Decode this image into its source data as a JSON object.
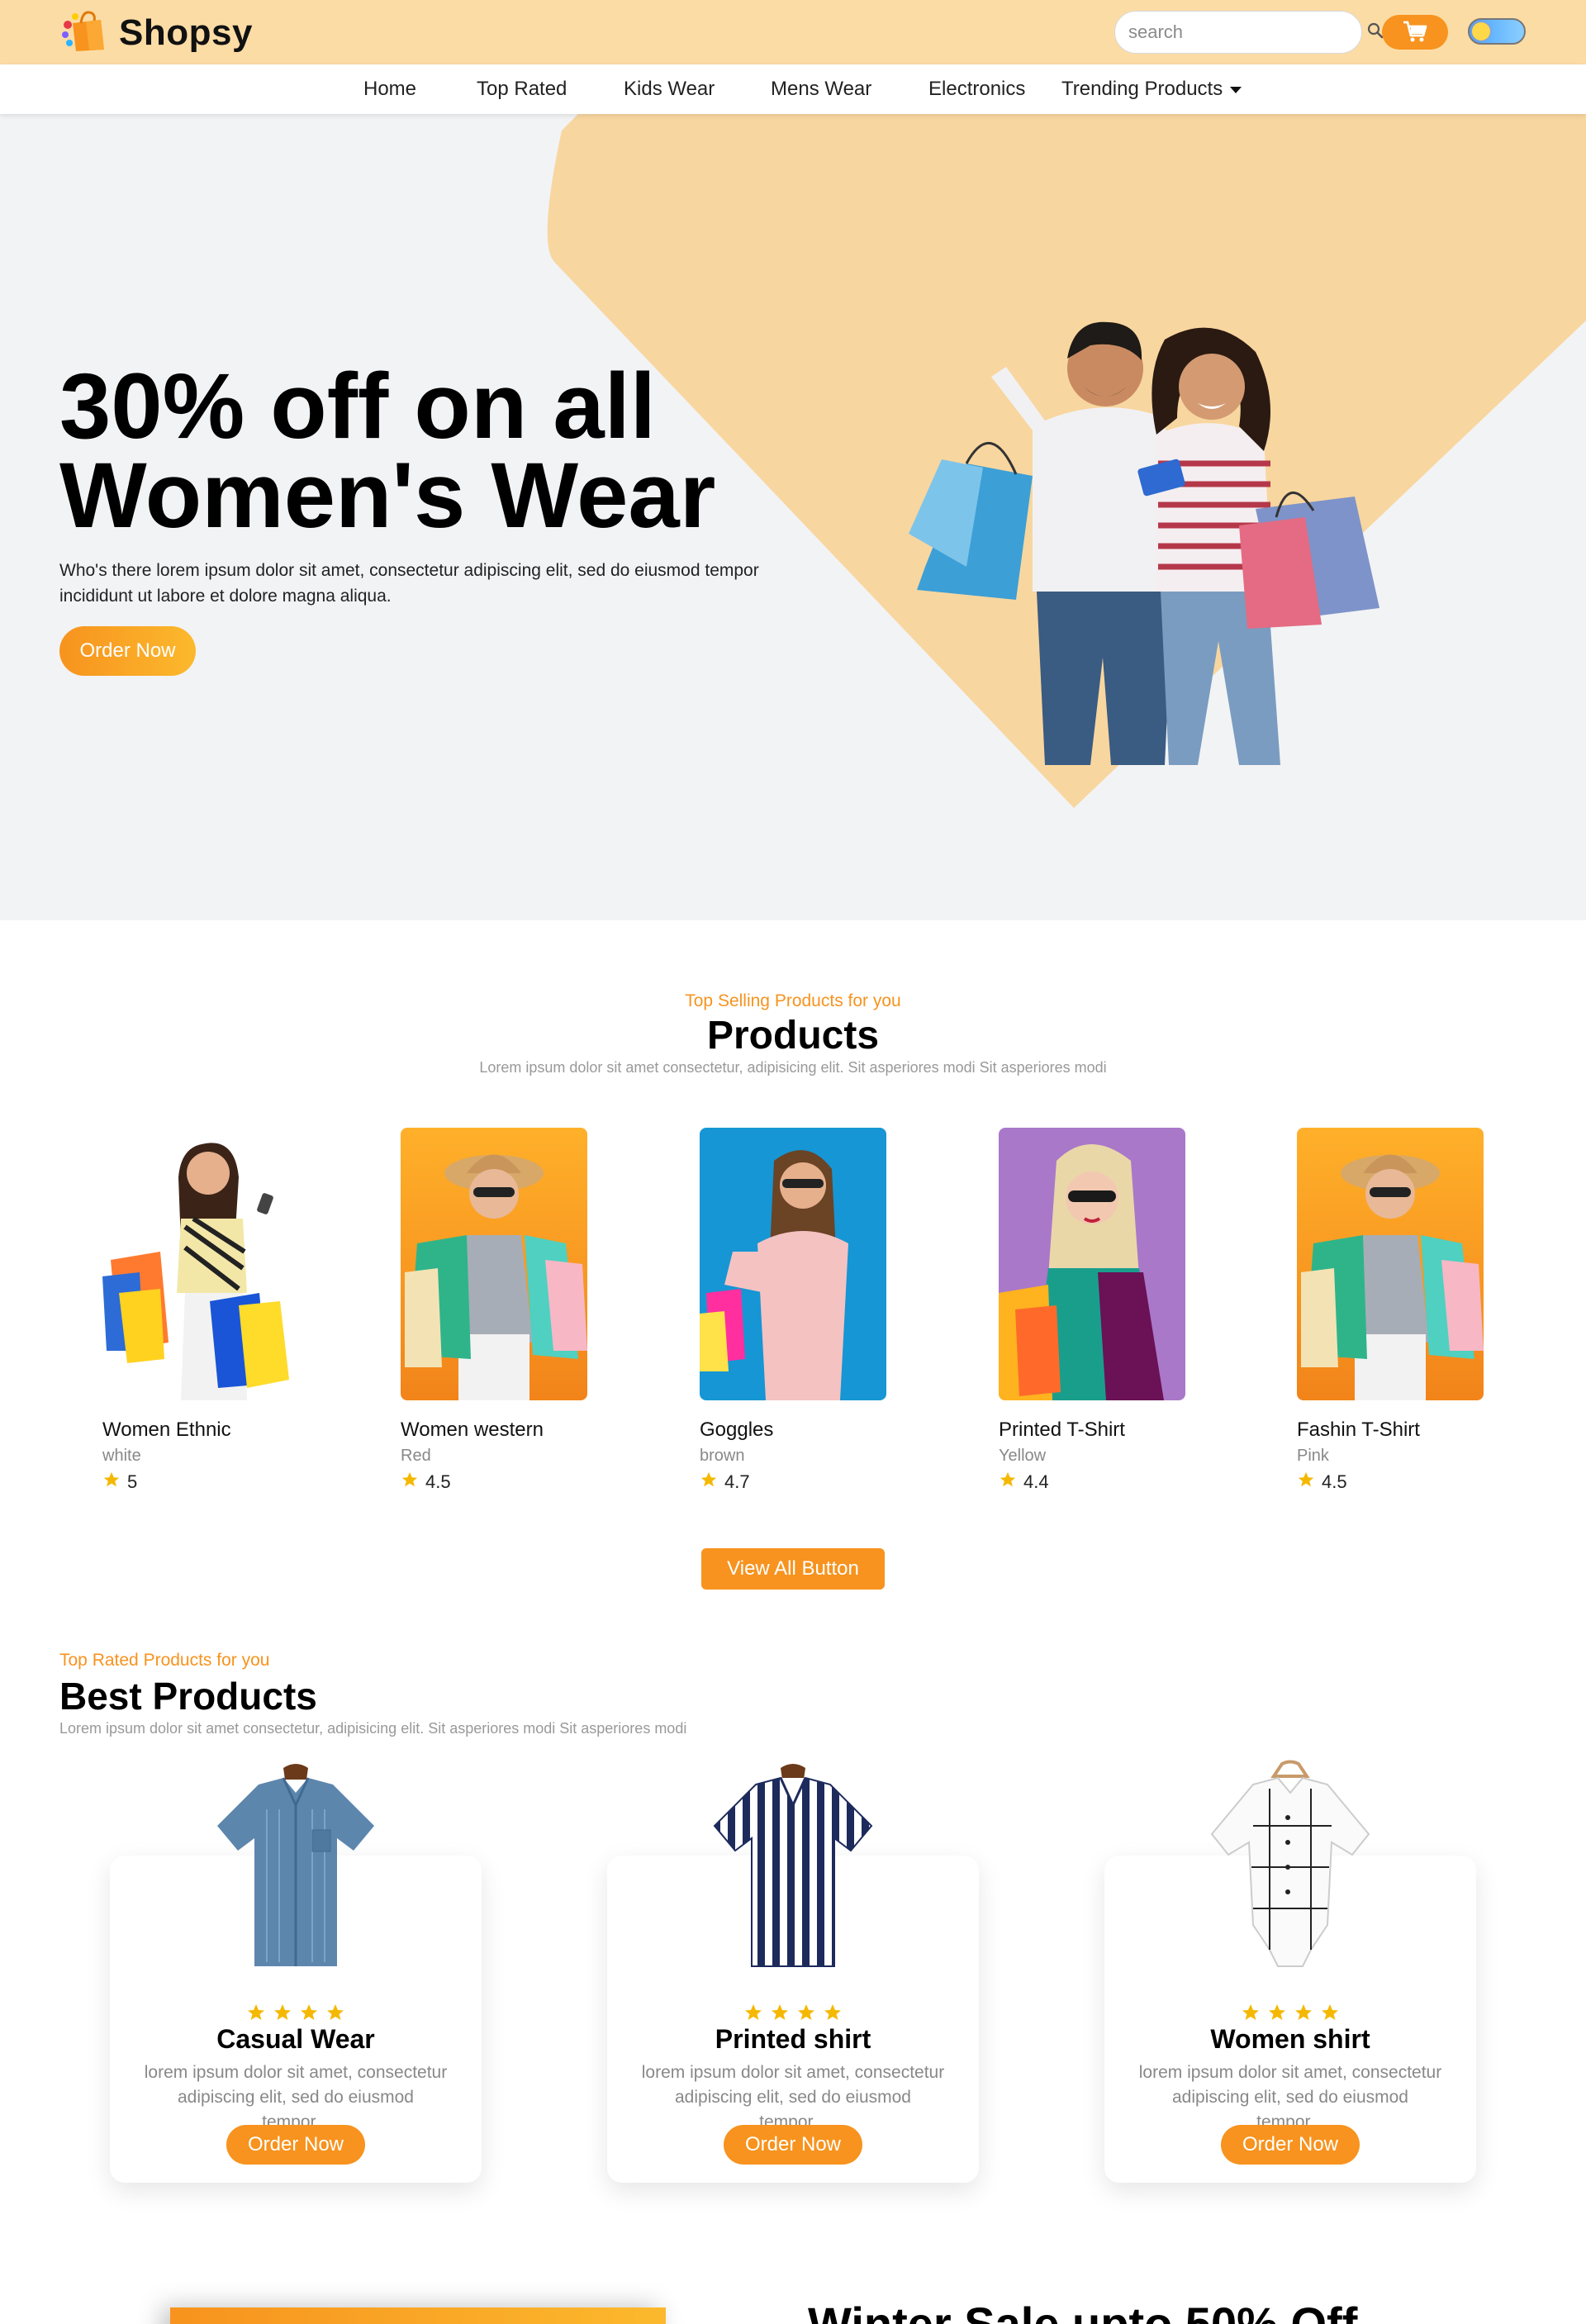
{
  "header": {
    "brand": "Shopsy",
    "search_placeholder": "search"
  },
  "nav": {
    "items": [
      "Home",
      "Top Rated",
      "Kids Wear",
      "Mens Wear",
      "Electronics",
      "Trending Products"
    ]
  },
  "hero": {
    "title_line1": "30% off on all",
    "title_line2": "Women's Wear",
    "subtitle": "Who's there lorem ipsum dolor sit amet, consectetur adipiscing elit, sed do eiusmod tempor incididunt ut labore et dolore magna aliqua.",
    "cta": "Order Now"
  },
  "products": {
    "eyebrow": "Top Selling Products for you",
    "title": "Products",
    "description": "Lorem ipsum dolor sit amet consectetur, adipisicing elit. Sit asperiores modi Sit asperiores modi",
    "items": [
      {
        "name": "Women Ethnic",
        "color": "white",
        "rating": "5"
      },
      {
        "name": "Women western",
        "color": "Red",
        "rating": "4.5"
      },
      {
        "name": "Goggles",
        "color": "brown",
        "rating": "4.7"
      },
      {
        "name": "Printed T-Shirt",
        "color": "Yellow",
        "rating": "4.4"
      },
      {
        "name": "Fashin T-Shirt",
        "color": "Pink",
        "rating": "4.5"
      }
    ],
    "view_all": "View All Button"
  },
  "best": {
    "eyebrow": "Top Rated Products for you",
    "title": "Best Products",
    "description": "Lorem ipsum dolor sit amet consectetur, adipisicing elit. Sit asperiores modi Sit asperiores modi",
    "items": [
      {
        "title": "Casual Wear",
        "desc": "lorem ipsum dolor sit amet, consectetur adipiscing elit, sed do eiusmod tempor...",
        "cta": "Order Now",
        "stars": 4
      },
      {
        "title": "Printed shirt",
        "desc": "lorem ipsum dolor sit amet, consectetur adipiscing elit, sed do eiusmod tempor...",
        "cta": "Order Now",
        "stars": 4
      },
      {
        "title": "Women shirt",
        "desc": "lorem ipsum dolor sit amet, consectetur adipiscing elit, sed do eiusmod tempor...",
        "cta": "Order Now",
        "stars": 4
      }
    ]
  },
  "winter": {
    "title": "Winter Sale upto 50% Off"
  },
  "colors": {
    "accent": "#f7931e",
    "header_bg": "#fcdca5",
    "hero_shape": "#f8d69f",
    "star": "#f5b800"
  },
  "icons": {
    "logo": "shopping-bag-icon",
    "search": "search-icon",
    "cart": "cart-icon",
    "theme": "theme-toggle-icon",
    "caret": "caret-down-icon",
    "star": "star-icon"
  }
}
